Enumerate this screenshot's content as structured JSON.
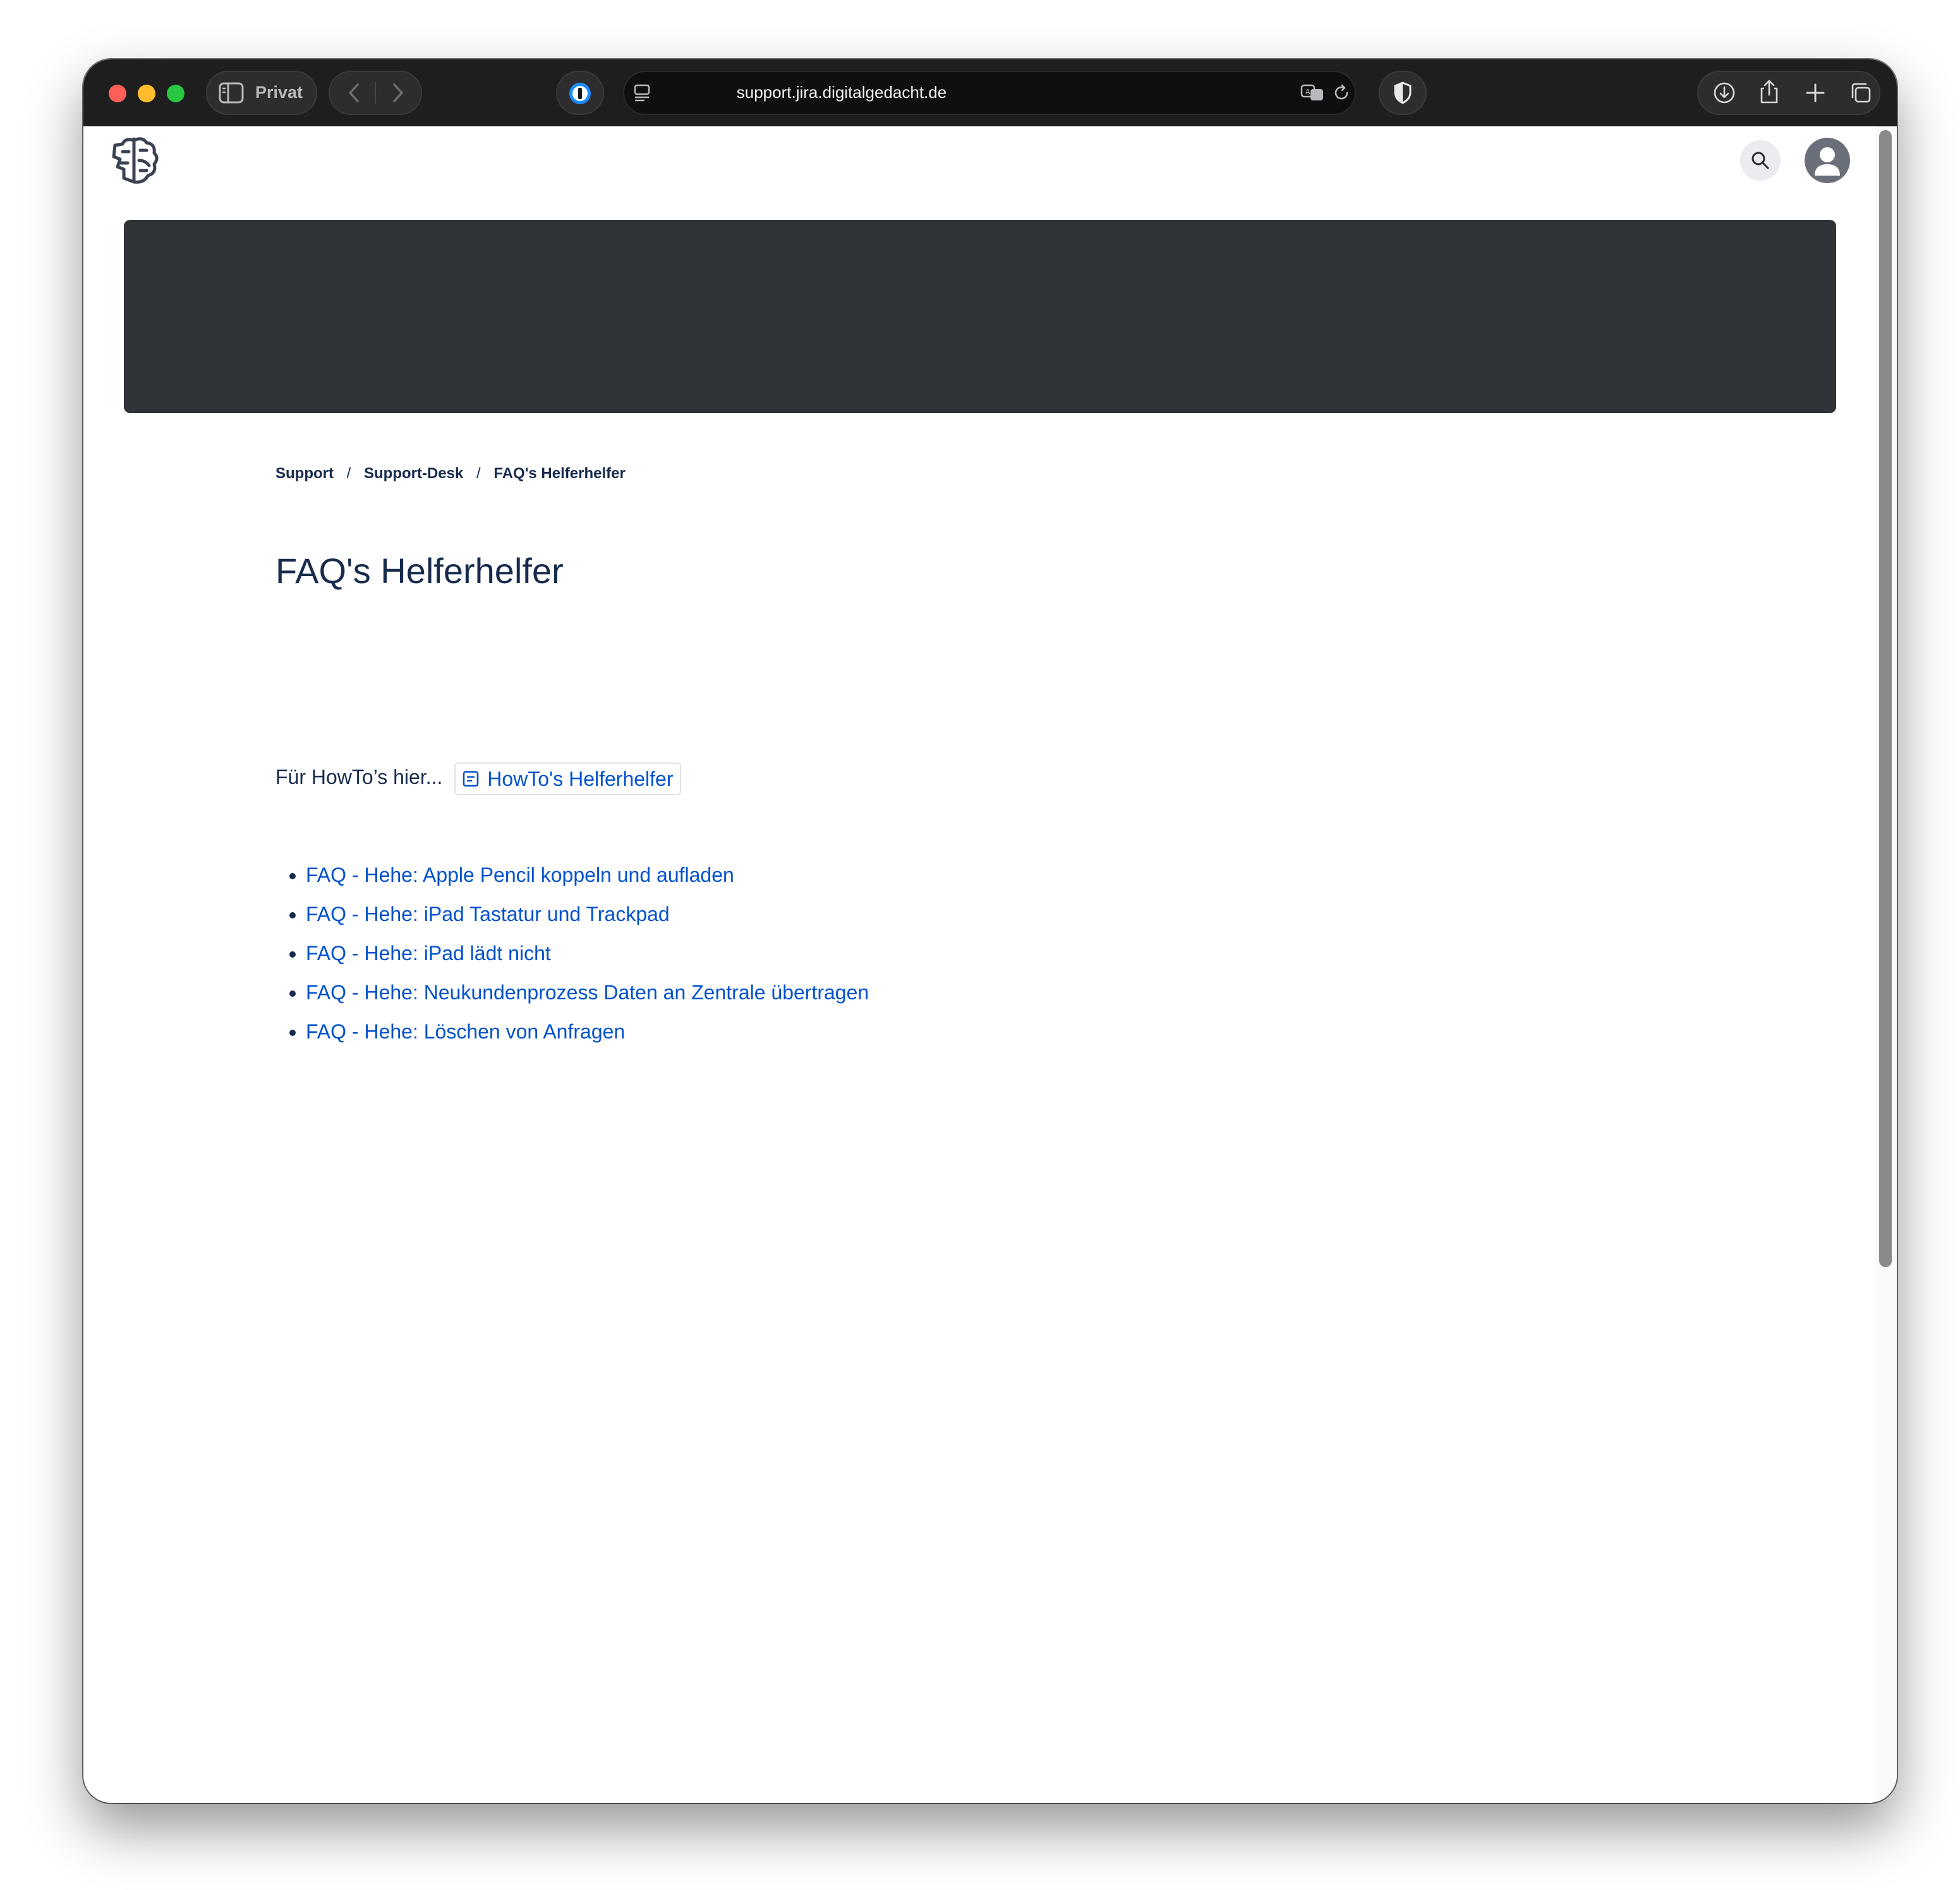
{
  "browser": {
    "sidebar_label": "Privat",
    "address": "support.jira.digitalgedacht.de",
    "colors": {
      "toolbar_bg": "#1e1e1f",
      "traffic_red": "#fe5f57",
      "traffic_yellow": "#febc2e",
      "traffic_green": "#28c840"
    },
    "toolbar_icons": [
      "sidebar-icon",
      "back-icon",
      "forward-icon",
      "password-manager-icon",
      "page-menu-icon",
      "translate-icon",
      "reload-icon",
      "shield-icon",
      "download-icon",
      "share-icon",
      "new-tab-icon",
      "tab-overview-icon"
    ]
  },
  "header": {
    "logo_icon": "brain-logo-icon",
    "search_icon": "search-icon",
    "avatar_icon": "user-avatar-icon"
  },
  "banner": {
    "color": "#2f3337"
  },
  "breadcrumb": [
    {
      "label": "Support"
    },
    {
      "label": "Support-Desk"
    },
    {
      "label": "FAQ's Helferhelfer"
    }
  ],
  "breadcrumb_separator": "/",
  "page": {
    "title": "FAQ's Helferhelfer",
    "intro_text": "Für HowTo’s hier...",
    "intro_link": "HowTo's Helferhelfer",
    "intro_link_icon": "page-icon"
  },
  "faq_links": [
    {
      "label": "FAQ - Hehe: Apple Pencil koppeln und aufladen"
    },
    {
      "label": "FAQ - Hehe: iPad Tastatur und Trackpad"
    },
    {
      "label": "FAQ - Hehe: iPad lädt nicht"
    },
    {
      "label": "FAQ - Hehe: Neukundenprozess Daten an Zentrale übertragen"
    },
    {
      "label": "FAQ - Hehe: Löschen von Anfragen"
    }
  ],
  "colors": {
    "link": "#0052cc",
    "text": "#172b4d"
  }
}
